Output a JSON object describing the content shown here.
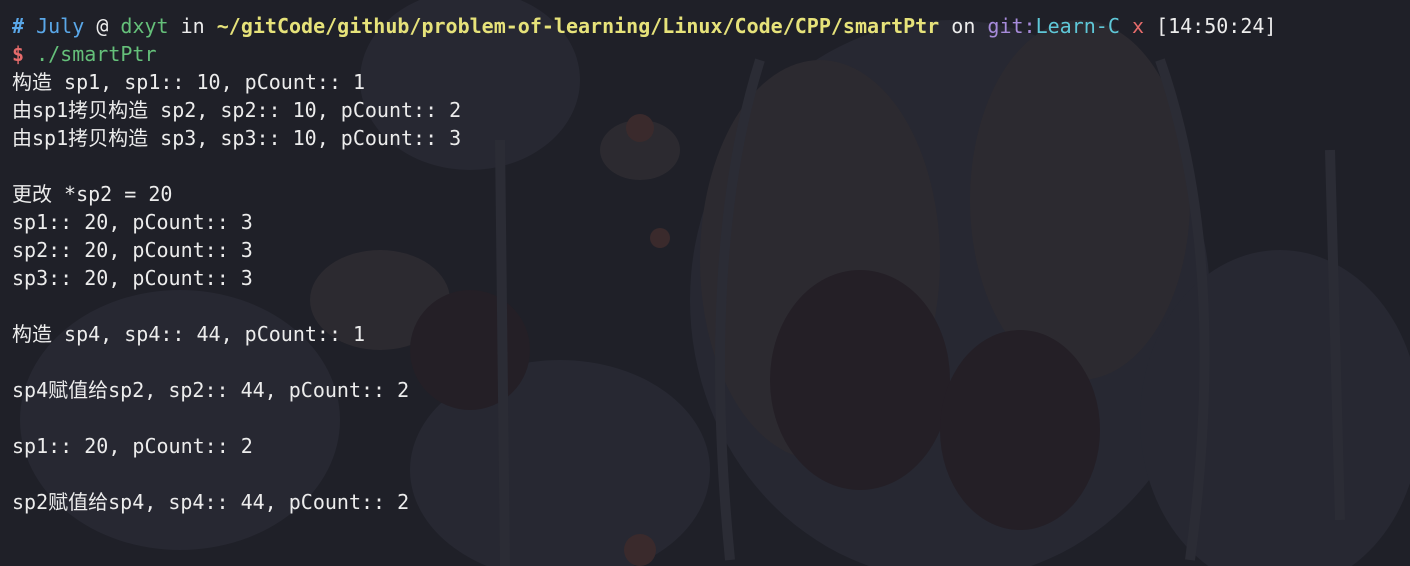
{
  "prompt": {
    "hash": "#",
    "user": "July",
    "at": "@",
    "host": "dxyt",
    "in": "in",
    "path": "~/gitCode/github/problem-of-learning/Linux/Code/CPP/smartPtr",
    "on": "on",
    "git_label": "git:",
    "branch": "Learn-C",
    "dirty": "x",
    "time": "[14:50:24]",
    "dollar": "$",
    "command": "./smartPtr"
  },
  "output": [
    "构造 sp1, sp1:: 10, pCount:: 1",
    "由sp1拷贝构造 sp2, sp2:: 10, pCount:: 2",
    "由sp1拷贝构造 sp3, sp3:: 10, pCount:: 3",
    "",
    "更改 *sp2 = 20",
    "sp1:: 20, pCount:: 3",
    "sp2:: 20, pCount:: 3",
    "sp3:: 20, pCount:: 3",
    "",
    "构造 sp4, sp4:: 44, pCount:: 1",
    "",
    "sp4赋值给sp2, sp2:: 44, pCount:: 2",
    "",
    "sp1:: 20, pCount:: 2",
    "",
    "sp2赋值给sp4, sp4:: 44, pCount:: 2"
  ],
  "colors": {
    "background": "#1f2028",
    "text": "#ececec",
    "user": "#5aa7e8",
    "host": "#65c07a",
    "path": "#e6e27a",
    "git_label": "#a78bdb",
    "branch": "#5fc8d8",
    "dirty": "#e56b6b",
    "command": "#65c07a"
  }
}
